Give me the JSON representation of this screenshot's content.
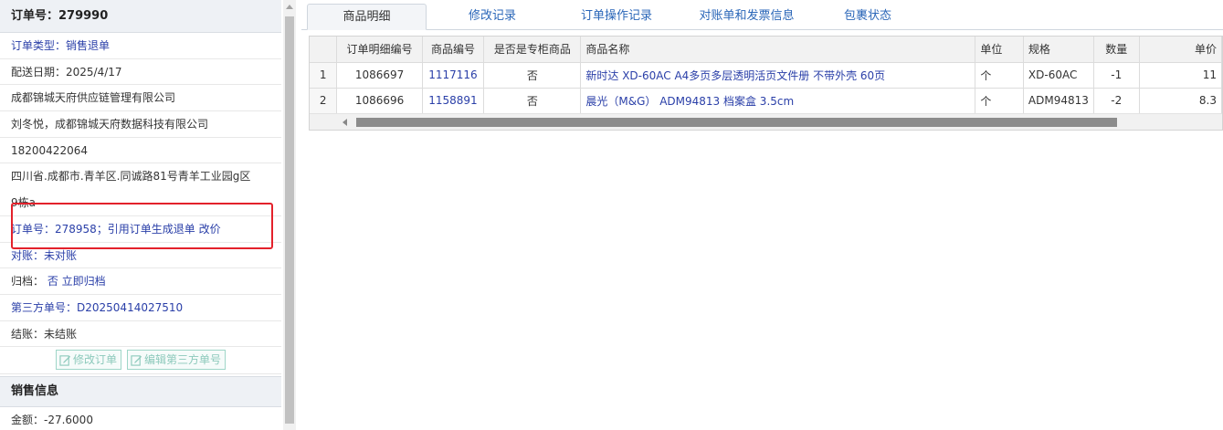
{
  "left": {
    "order_title": "订单号：279990",
    "order_type": "订单类型：销售退单",
    "delivery_date": "配送日期：2025/4/17",
    "supplier": "成都锦城天府供应链管理有限公司",
    "contact": "刘冬悦，成都锦城天府数据科技有限公司",
    "phone": "18200422064",
    "address_line1": "四川省.成都市.青羊区.同诚路81号青羊工业园g区",
    "address_line2": "9栋a",
    "ref_order_label": "订单号：278958；引用订单生成退单",
    "ref_order_link": "改价",
    "reconcile_label": "对账：",
    "reconcile_value": "未对账",
    "archive_label": "归档：",
    "archive_value": "否 立即归档",
    "third_party_label": "第三方单号：",
    "third_party_value": "D20250414027510",
    "settle": "结账：未结账",
    "edit_order_button": "修改订单",
    "edit_third_party_button": "编辑第三方单号",
    "sales_section": "销售信息",
    "amount": "金额：-27.6000"
  },
  "tabs": [
    "商品明细",
    "修改记录",
    "订单操作记录",
    "对账单和发票信息",
    "包裹状态"
  ],
  "grid": {
    "columns": [
      "",
      "订单明细编号",
      "商品编号",
      "是否是专柜商品",
      "商品名称",
      "单位",
      "规格",
      "数量",
      "单价"
    ],
    "rows": [
      [
        "1",
        "1086697",
        "1117116",
        "否",
        "新时达 XD-60AC A4多页多层透明活页文件册 不带外壳 60页",
        "个",
        "XD-60AC",
        "-1",
        "11"
      ],
      [
        "2",
        "1086696",
        "1158891",
        "否",
        "晨光（M&G） ADM94813 档案盒 3.5cm",
        "个",
        "ADM94813",
        "-2",
        "8.3"
      ]
    ]
  },
  "colors": {
    "link": "#2a3fa8",
    "highlight": "#e3212b",
    "header_bg": "#eef1f5"
  }
}
